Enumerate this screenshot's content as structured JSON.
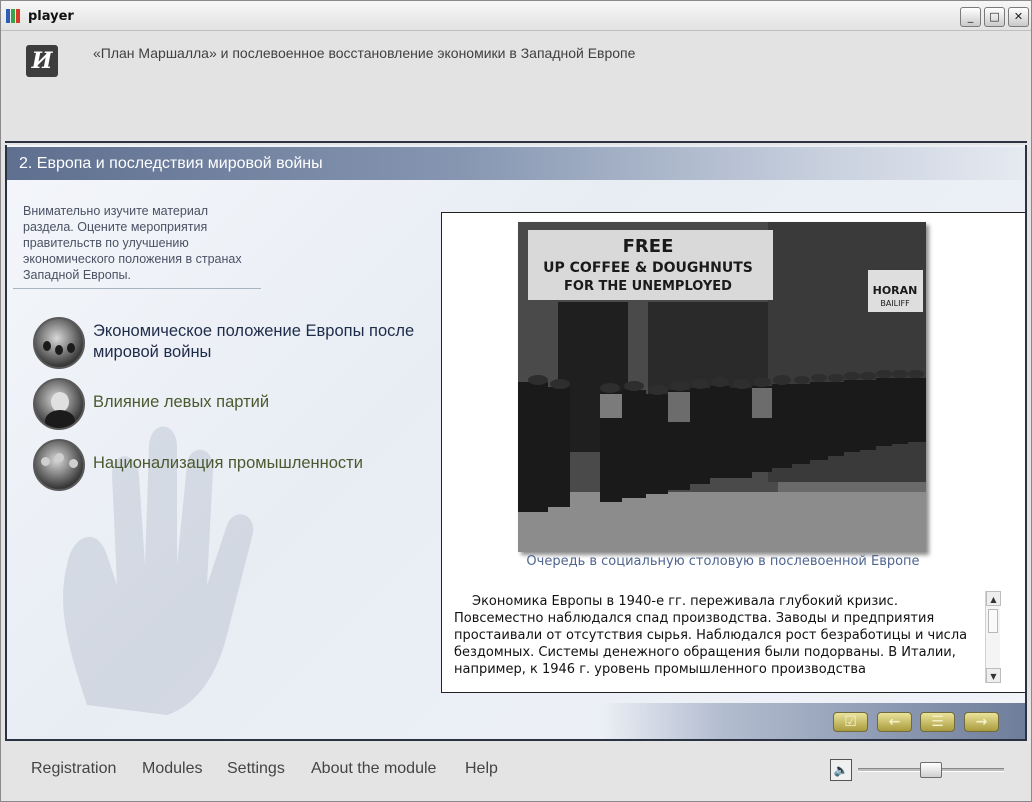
{
  "window": {
    "title": "player",
    "controls": {
      "minimize": "_",
      "maximize": "□",
      "close": "✕"
    }
  },
  "course": {
    "logo_glyph": "И",
    "title": "«План Маршалла» и послевоенное восстановление экономики в Западной Европе"
  },
  "section": {
    "title": "2. Европа и последствия мировой войны"
  },
  "instructions": "Внимательно изучите материал раздела. Оцените мероприятия правительств по улучшению экономического положения в странах Западной Европы.",
  "topics": [
    {
      "label": "Экономическое положение Европы после мировой войны",
      "active": true
    },
    {
      "label": "Влияние левых партий",
      "active": false
    },
    {
      "label": "Национализация промышленности",
      "active": false
    }
  ],
  "photo": {
    "sign_line1": "FREE",
    "sign_line2": "UP COFFEE & DOUGHNUTS",
    "sign_line3": "FOR THE UNEMPLOYED",
    "side_sign": "HORAN",
    "side_sign2": "BAILIFF"
  },
  "caption": "Очередь в социальную столовую в послевоенной Европе",
  "body_text": "Экономика Европы в 1940-е гг. переживала глубокий кризис. Повсеместно наблюдался спад производства. Заводы и предприятия простаивали от отсутствия сырья. Наблюдался рост безработицы и числа бездомных. Системы денежного обращения были подорваны. В Италии, например, к 1946 г. уровень промышленного производства",
  "nav_buttons": {
    "check": "☑",
    "back": "←",
    "list": "☰",
    "next": "→"
  },
  "footer_menu": [
    "Registration",
    "Modules",
    "Settings",
    "About the module",
    "Help"
  ],
  "colors": {
    "section_bar": "#5e6f8f",
    "active_topic": "#1e2c4a",
    "topic": "#4a5a30",
    "caption": "#4f6590",
    "nav_button": "#d8cf7a"
  },
  "icons": {
    "mute": "speaker-icon"
  },
  "volume": 0.55
}
